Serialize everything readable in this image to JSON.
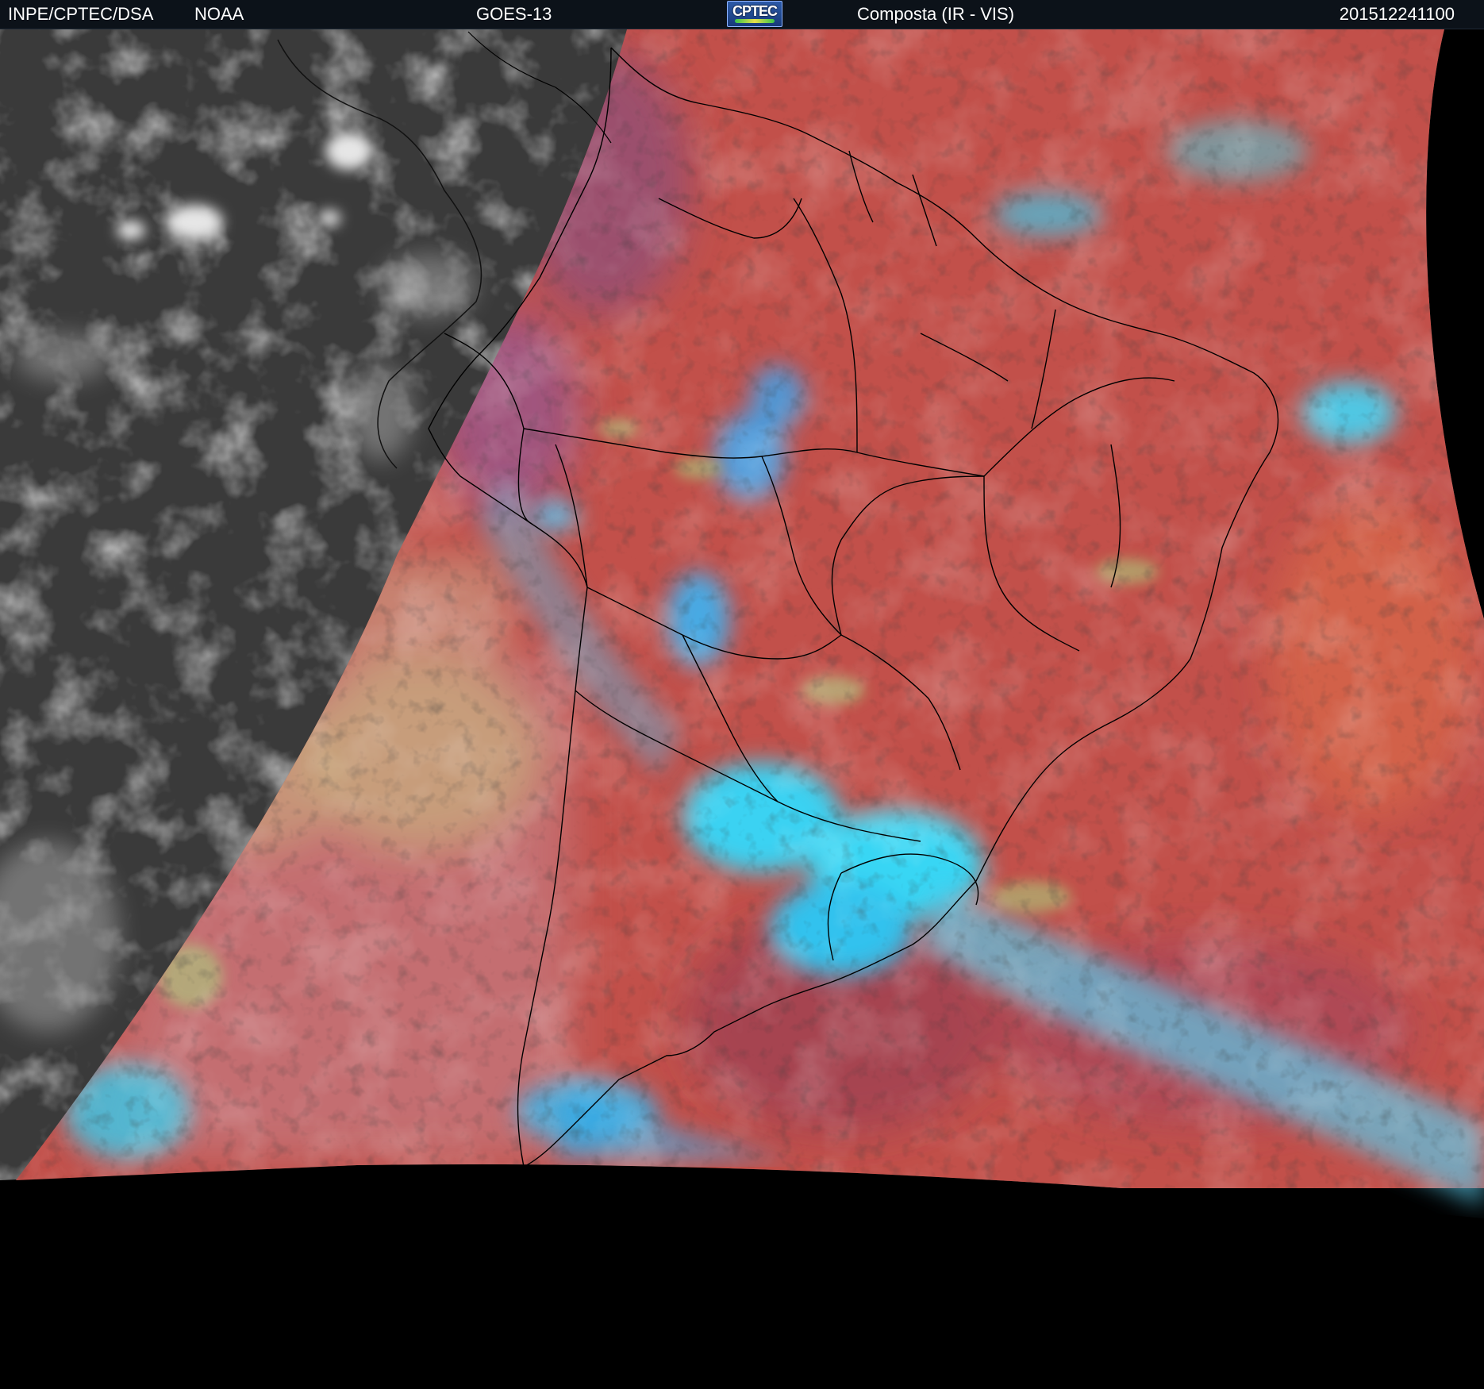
{
  "header": {
    "organization": "INPE/CPTEC/DSA",
    "agency": "NOAA",
    "satellite": "GOES-13",
    "logo_text": "CPTEC",
    "product": "Composta (IR - VIS)",
    "timestamp": "201512241100"
  },
  "colors": {
    "header_background": "#0c1219",
    "header_text": "#ffffff",
    "outside_disk": "#000000",
    "ir_grayscale": "#3a3a3a",
    "composite_land_clear": "#b84040",
    "composite_ocean_clear": "#c2504a",
    "cold_cloud_tops": "#38d0f0",
    "low_cloud": "#9ad080",
    "borders": "#000000"
  },
  "icons": {
    "logo": "cptec-logo"
  }
}
